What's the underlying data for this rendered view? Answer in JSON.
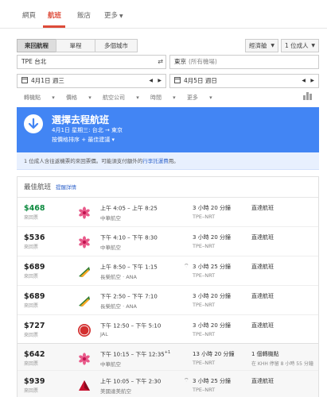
{
  "nav": {
    "tabs": [
      {
        "label": "網頁"
      },
      {
        "label": "航班"
      },
      {
        "label": "飯店"
      },
      {
        "label": "更多"
      }
    ]
  },
  "trip": {
    "types": [
      "來回航程",
      "單程",
      "多個城市"
    ],
    "cabin": "經濟艙",
    "passengers": "1 位成人"
  },
  "search": {
    "origin_code": "TPE",
    "origin_city": "台北",
    "dest_city": "東京",
    "dest_sub": "(所有機場)",
    "depart_date": "4月1日 週三",
    "return_date": "4月5日 週日"
  },
  "filters": [
    "轉機點",
    "價格",
    "航空公司",
    "時間",
    "更多"
  ],
  "hero": {
    "title": "選擇去程航班",
    "subtitle": "4月1日 星期三: 台北 → 東京",
    "sort": "按價格排序 + 最佳建議"
  },
  "info": {
    "text": "1 位成人含往返機票的來回票價。可能須支付額外的",
    "link": "行李託運費",
    "suffix": "用。"
  },
  "best": {
    "title": "最佳航班",
    "hint": "提醒詳情"
  },
  "flights": [
    {
      "price": "$468",
      "ptype": "來回票",
      "times": "上午 4:05 – 上午 8:25",
      "plus": "",
      "carrier": "中華航空",
      "wifi": "",
      "duration": "3 小時 20 分鐘",
      "route": "TPE–NRT",
      "stops": "直達航班",
      "stops_detail": "",
      "logo": "china-airlines"
    },
    {
      "price": "$536",
      "ptype": "來回票",
      "times": "下午 4:10 – 下午 8:30",
      "plus": "",
      "carrier": "中華航空",
      "wifi": "",
      "duration": "3 小時 20 分鐘",
      "route": "TPE–NRT",
      "stops": "直達航班",
      "stops_detail": "",
      "logo": "china-airlines"
    },
    {
      "price": "$689",
      "ptype": "來回票",
      "times": "上午 8:50 – 下午 1:15",
      "plus": "",
      "carrier": "長榮航空 · ANA",
      "wifi": "wifi",
      "duration": "3 小時 25 分鐘",
      "route": "TPE–NRT",
      "stops": "直達航班",
      "stops_detail": "",
      "logo": "eva-air"
    },
    {
      "price": "$689",
      "ptype": "來回票",
      "times": "下午 2:50 – 下午 7:10",
      "plus": "",
      "carrier": "長榮航空 · ANA",
      "wifi": "",
      "duration": "3 小時 20 分鐘",
      "route": "TPE–NRT",
      "stops": "直達航班",
      "stops_detail": "",
      "logo": "eva-air"
    },
    {
      "price": "$727",
      "ptype": "來回票",
      "times": "下午 12:50 – 下午 5:10",
      "plus": "",
      "carrier": "JAL",
      "wifi": "",
      "duration": "3 小時 20 分鐘",
      "route": "TPE–NRT",
      "stops": "直達航班",
      "stops_detail": "",
      "logo": "jal"
    }
  ],
  "others": [
    {
      "price": "$642",
      "ptype": "來回票",
      "times": "下午 10:15 – 下午 12:35",
      "plus": "+1",
      "carrier": "中華航空",
      "wifi": "",
      "duration": "13 小時 20 分鐘",
      "route": "TPE–NRT",
      "stops": "1 個轉機點",
      "stops_detail": "在 KHH 停留 8 小時 55 分鐘",
      "logo": "china-airlines"
    },
    {
      "price": "$939",
      "ptype": "來回票",
      "times": "上午 10:05 – 下午 2:30",
      "plus": "",
      "carrier": "美國達美航空",
      "wifi": "wifi",
      "duration": "3 小時 25 分鐘",
      "route": "TPE–NRT",
      "stops": "直達航班",
      "stops_detail": "",
      "logo": "delta"
    }
  ],
  "colors": {
    "accent_red": "#dd4b39",
    "hero_blue": "#4285f4",
    "cheap_green": "#0d8a3f"
  }
}
